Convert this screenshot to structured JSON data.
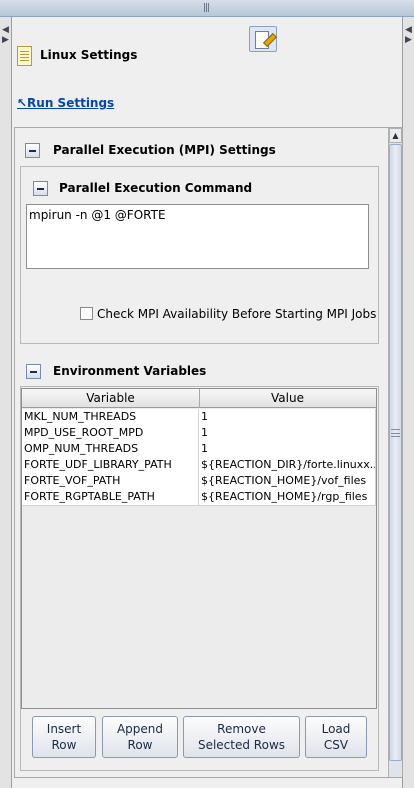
{
  "panel": {
    "title": "Linux Settings",
    "run_link": "↖Run Settings"
  },
  "mpi_section": {
    "title": "Parallel Execution (MPI) Settings",
    "command_group_title": "Parallel Execution Command",
    "command_value": "mpirun -n @1 @FORTE",
    "check_label": "Check MPI Availability Before Starting MPI Jobs",
    "check_checked": false
  },
  "env_section": {
    "title": "Environment Variables",
    "columns": [
      "Variable",
      "Value"
    ],
    "rows": [
      [
        "MKL_NUM_THREADS",
        "1"
      ],
      [
        "MPD_USE_ROOT_MPD",
        "1"
      ],
      [
        "OMP_NUM_THREADS",
        "1"
      ],
      [
        "FORTE_UDF_LIBRARY_PATH",
        "${REACTION_DIR}/forte.linuxx..."
      ],
      [
        "FORTE_VOF_PATH",
        "${REACTION_HOME}/vof_files"
      ],
      [
        "FORTE_RGPTABLE_PATH",
        "${REACTION_HOME}/rgp_files"
      ]
    ]
  },
  "buttons": {
    "insert": "Insert\nRow",
    "append": "Append\nRow",
    "remove": "Remove\nSelected Rows",
    "load": "Load\nCSV"
  },
  "icons": {
    "splitter_grip": "grip-icon",
    "panel": "document-icon",
    "edit": "edit-document-icon",
    "collapse": "collapse-minus-icon"
  }
}
